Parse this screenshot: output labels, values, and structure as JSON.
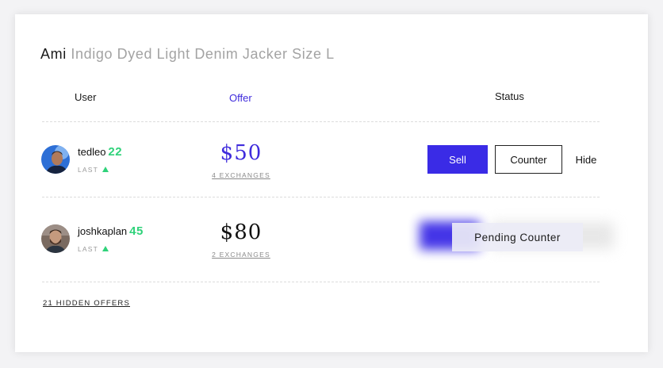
{
  "product": {
    "brand": "Ami",
    "name": "Indigo Dyed Light Denim Jacker Size L"
  },
  "columns": {
    "user": "User",
    "offer": "Offer",
    "status": "Status"
  },
  "offers": [
    {
      "username": "tedleo",
      "score": "22",
      "trend_label": "LAST",
      "price": "$50",
      "price_color": "#3f2bdc",
      "exchanges": "4 EXCHANGES",
      "actions": {
        "sell": "Sell",
        "counter": "Counter",
        "hide": "Hide"
      }
    },
    {
      "username": "joshkaplan",
      "score": "45",
      "trend_label": "LAST",
      "price": "$80",
      "price_color": "#111111",
      "exchanges": "2 EXCHANGES",
      "status": "Pending Counter"
    }
  ],
  "hidden_offers": "21 HIDDEN OFFERS",
  "colors": {
    "accent": "#3a2be6",
    "score": "#2fd27a"
  }
}
